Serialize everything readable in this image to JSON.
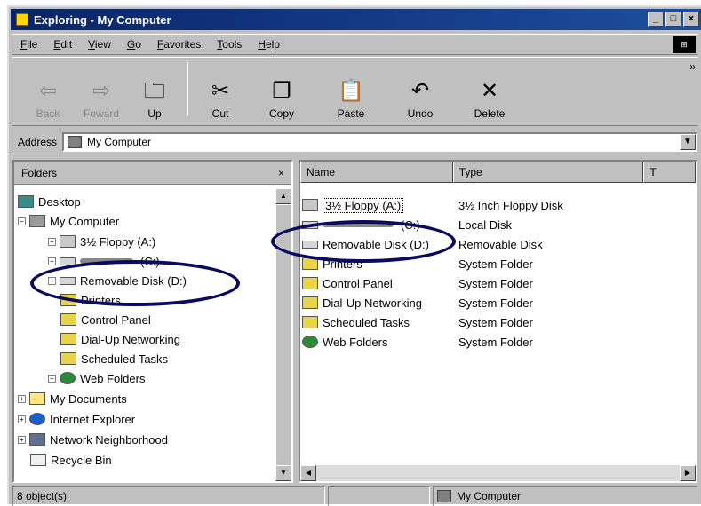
{
  "window": {
    "title": "Exploring - My Computer",
    "minimize": "_",
    "maximize": "□",
    "close": "×"
  },
  "menu": [
    "File",
    "Edit",
    "View",
    "Go",
    "Favorites",
    "Tools",
    "Help"
  ],
  "toolbar": {
    "back": "Back",
    "forward": "Foward",
    "up": "Up",
    "cut": "Cut",
    "copy": "Copy",
    "paste": "Paste",
    "undo": "Undo",
    "delete": "Delete",
    "more": "»"
  },
  "address": {
    "label": "Address",
    "value": "My Computer"
  },
  "folders": {
    "header": "Folders",
    "close": "×",
    "items": [
      "Desktop",
      "My Computer",
      "3½ Floppy (A:)",
      "(C:)",
      "Removable Disk (D:)",
      "Printers",
      "Control Panel",
      "Dial-Up Networking",
      "Scheduled Tasks",
      "Web Folders",
      "My Documents",
      "Internet Explorer",
      "Network Neighborhood",
      "Recycle Bin"
    ]
  },
  "files": {
    "columns": [
      "Name",
      "Type",
      "T"
    ],
    "rows": [
      {
        "name": "3½ Floppy (A:)",
        "type": "3½ Inch Floppy Disk"
      },
      {
        "name": "(C:)",
        "type": "Local Disk"
      },
      {
        "name": "Removable Disk (D:)",
        "type": "Removable Disk"
      },
      {
        "name": "Printers",
        "type": "System Folder"
      },
      {
        "name": "Control Panel",
        "type": "System Folder"
      },
      {
        "name": "Dial-Up Networking",
        "type": "System Folder"
      },
      {
        "name": "Scheduled Tasks",
        "type": "System Folder"
      },
      {
        "name": "Web Folders",
        "type": "System Folder"
      }
    ]
  },
  "status": {
    "count": "8 object(s)",
    "location": "My Computer"
  }
}
